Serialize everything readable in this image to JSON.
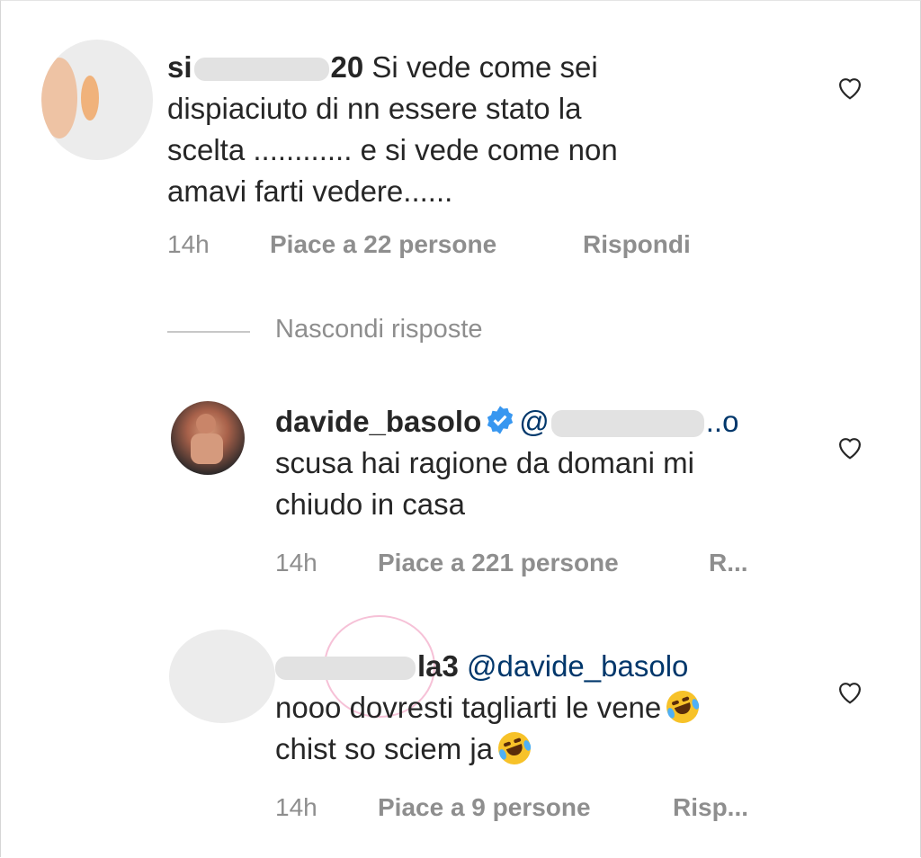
{
  "comments": [
    {
      "username_visible": "si",
      "username_tail": "20",
      "text_line1": "Si vede come sei",
      "text_line2": "dispiaciuto di nn essere stato la",
      "text_line3": "scelta ............ e si vede come non",
      "text_line4": "amavi farti vedere......",
      "time": "14h",
      "likes": "Piace a 22 persone",
      "reply": "Rispondi"
    },
    {
      "username": "davide_basolo",
      "mention_start": "@",
      "mention_tail": "..o",
      "text_line1": "scusa hai ragione da domani mi",
      "text_line2": "chiudo in casa",
      "time": "14h",
      "likes": "Piace a 221 persone",
      "reply": "R..."
    },
    {
      "username_tail": "la3",
      "mention": "@davide_basolo",
      "text_line1": "nooo dovresti tagliarti le vene",
      "text_line2": "chist so sciem ja",
      "time": "14h",
      "likes": "Piace a 9 persone",
      "reply": "Risp..."
    }
  ],
  "hide_replies": "Nascondi risposte",
  "colors": {
    "text": "#262626",
    "meta": "#8e8e8e",
    "mention": "#00376b",
    "verified": "#3897f0"
  },
  "icons": [
    "heart-outline-icon",
    "verified-badge-icon",
    "rolling-laughing-emoji"
  ]
}
